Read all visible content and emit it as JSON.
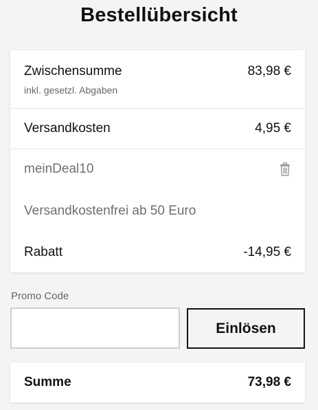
{
  "page_title": "Bestellübersicht",
  "summary": {
    "subtotal_label": "Zwischensumme",
    "subtotal_value": "83,98 €",
    "subtotal_note": "inkl. gesetzl. Abgaben",
    "shipping_label": "Versandkosten",
    "shipping_value": "4,95 €",
    "coupon_code": "meinDeal10",
    "coupon_remove_icon": "trash-icon",
    "coupon_description": "Versandkostenfrei ab 50 Euro",
    "discount_label": "Rabatt",
    "discount_value": "-14,95 €"
  },
  "promo": {
    "label": "Promo Code",
    "input_value": "",
    "input_placeholder": "",
    "redeem_label": "Einlösen"
  },
  "total": {
    "label": "Summe",
    "value": "73,98 €"
  }
}
